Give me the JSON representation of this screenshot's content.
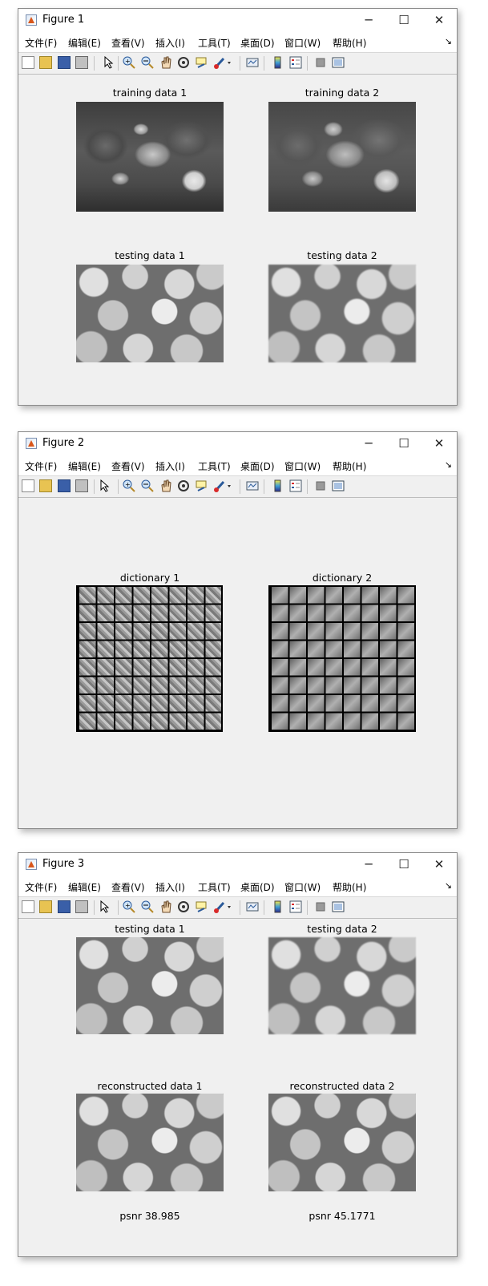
{
  "menu": [
    "文件(F)",
    "编辑(E)",
    "查看(V)",
    "插入(I)",
    "工具(T)",
    "桌面(D)",
    "窗口(W)",
    "帮助(H)"
  ],
  "window_controls": {
    "minimize": "─",
    "maximize": "☐",
    "close": "✕",
    "dock": "↘"
  },
  "toolbar_icons": [
    "new-figure-icon",
    "open-file-icon",
    "save-icon",
    "print-icon",
    "select-arrow-icon",
    "zoom-in-icon",
    "zoom-out-icon",
    "pan-hand-icon",
    "rotate-3d-icon",
    "data-cursor-icon",
    "brush-icon",
    "link-plot-icon",
    "insert-colorbar-icon",
    "insert-legend-icon",
    "hide-plot-tools-icon",
    "show-plot-tools-icon"
  ],
  "figure1": {
    "title": "Figure 1",
    "axes": {
      "a1": "training data 1",
      "a2": "training data 2",
      "a3": "testing data 1",
      "a4": "testing data 2"
    }
  },
  "figure2": {
    "title": "Figure 2",
    "axes": {
      "a1": "dictionary 1",
      "a2": "dictionary 2"
    }
  },
  "figure3": {
    "title": "Figure 3",
    "axes": {
      "a1": "testing data 1",
      "a2": "testing data 2",
      "a3": "reconstructed data 1",
      "a4": "reconstructed data 2"
    },
    "psnr1": "psnr 38.985",
    "psnr2": "psnr 45.1771"
  }
}
